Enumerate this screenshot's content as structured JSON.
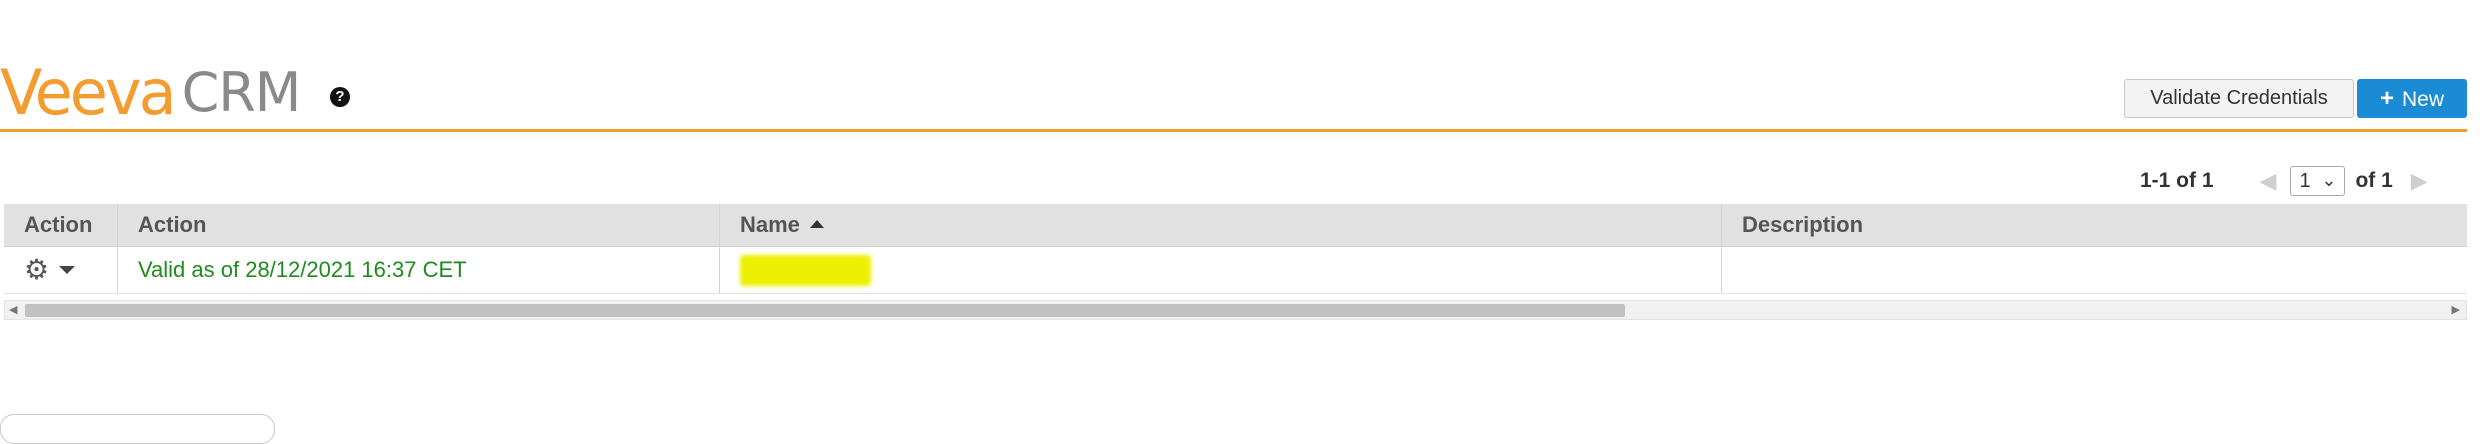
{
  "header": {
    "logo_primary": "Veeva",
    "logo_secondary": "CRM",
    "help_glyph": "?",
    "accent_color": "#f39c2f",
    "validate_label": "Validate Credentials",
    "new_label": "New",
    "new_icon": "plus-icon",
    "new_color": "#1a8bd4"
  },
  "pager": {
    "count": "1-1 of 1",
    "page": "1",
    "of_label": "of 1"
  },
  "table": {
    "columns": [
      "Action",
      "Action",
      "Name",
      "Description"
    ],
    "sort_column": "Name",
    "sort_direction": "ascending",
    "rows": [
      {
        "action_icons": [
          "gear-icon",
          "caret-down-icon"
        ],
        "status": "Valid as of 28/12/2021 16:37 CET",
        "status_color": "#1f8a1f",
        "name": "",
        "description": ""
      }
    ]
  }
}
